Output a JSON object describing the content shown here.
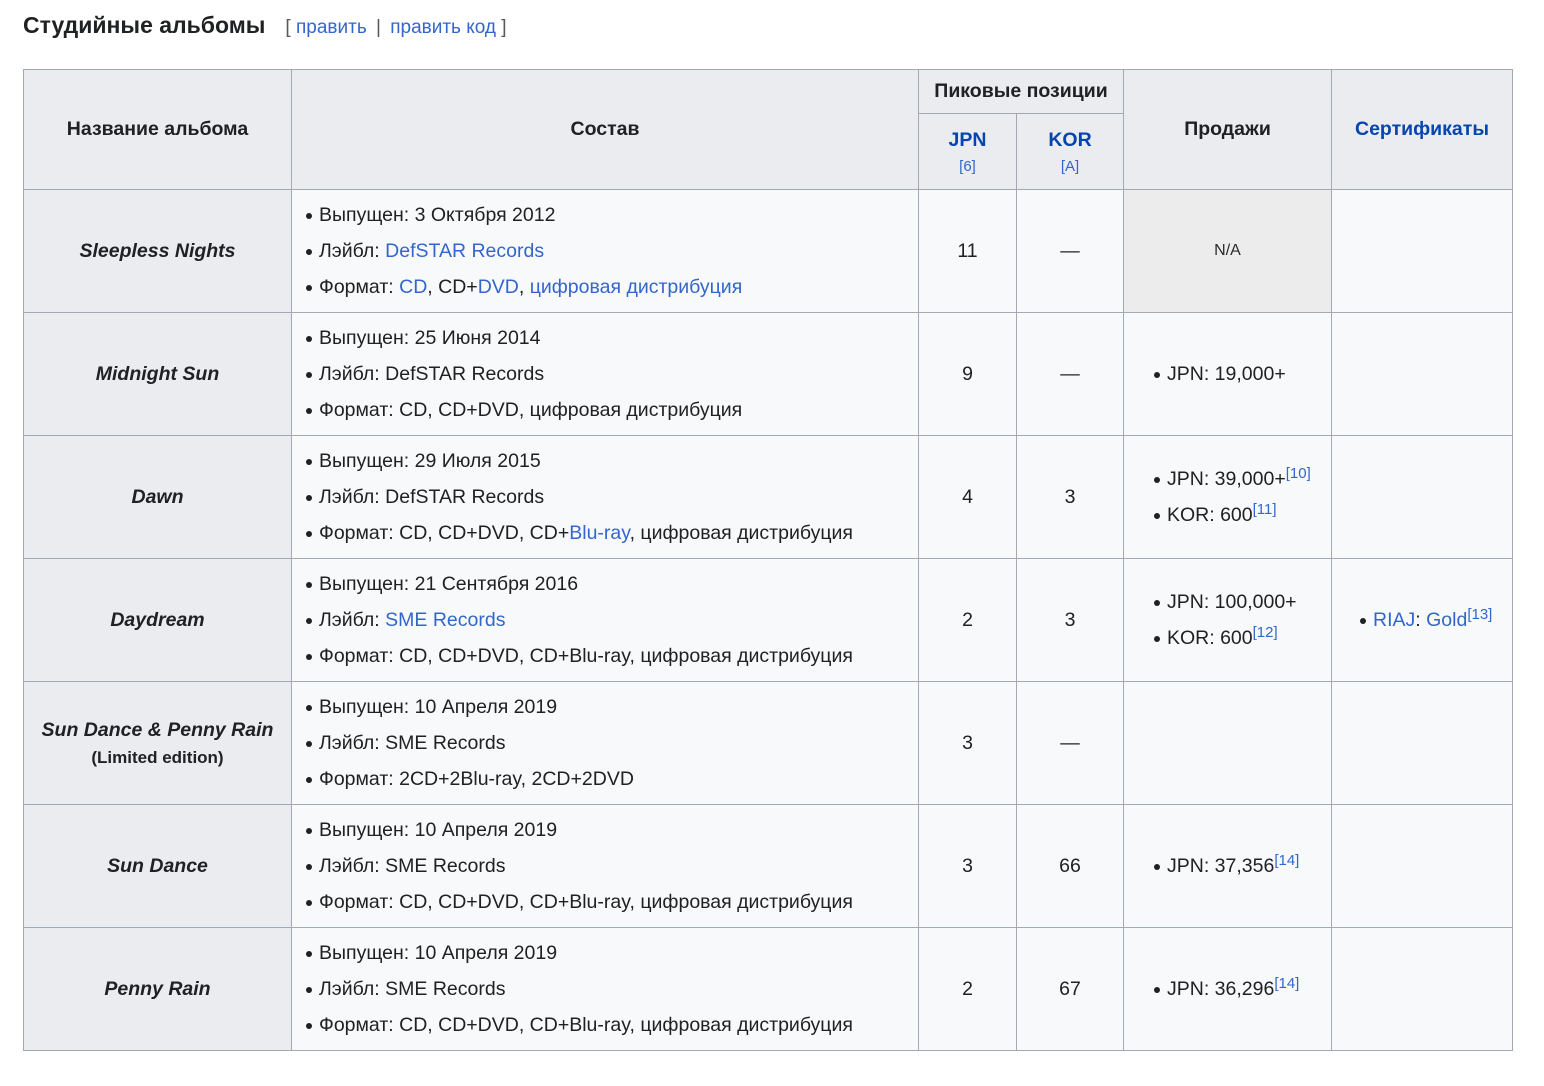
{
  "section": {
    "title": "Студийные альбомы",
    "edit_open": "[",
    "edit_label": "править",
    "edit_sep": "|",
    "edit_code_label": "править код",
    "edit_close": "]"
  },
  "headers": {
    "album": "Название альбома",
    "details": "Состав",
    "peak": "Пиковые позиции",
    "jpn": "JPN",
    "jpn_ref": "[6]",
    "kor": "KOR",
    "kor_ref": "[A]",
    "sales": "Продажи",
    "certs": "Сертификаты"
  },
  "labels": {
    "released": "Выпущен:",
    "label": "Лэйбл:",
    "format": "Формат:"
  },
  "rows": [
    {
      "title": "Sleepless Nights",
      "released": "3 Октября 2012",
      "label_name": "DefSTAR Records",
      "format_cd": "CD",
      "format_cddvd_prefix": "CD+",
      "format_dvd": "DVD",
      "format_digital": "цифровая дистрибуция",
      "jpn": "11",
      "kor": "—",
      "sales_na": "N/A"
    },
    {
      "title": "Midnight Sun",
      "released": "25 Июня 2014",
      "label_name": "DefSTAR Records",
      "format": "CD, CD+DVD, цифровая дистрибуция",
      "jpn": "9",
      "kor": "—",
      "sales": [
        "JPN: 19,000+"
      ]
    },
    {
      "title": "Dawn",
      "released": "29 Июля 2015",
      "label_name": "DefSTAR Records",
      "format_prefix": "CD, CD+DVD, CD+",
      "format_bluray": "Blu-ray",
      "format_suffix": ", цифровая дистрибуция",
      "jpn": "4",
      "kor": "3",
      "sales": [
        {
          "text": "JPN: 39,000+",
          "ref": "[10]"
        },
        {
          "text": "KOR: 600",
          "ref": "[11]"
        }
      ]
    },
    {
      "title": "Daydream",
      "released": "21 Сентября 2016",
      "label_name": "SME Records",
      "format": "CD, CD+DVD, CD+Blu-ray, цифровая дистрибуция",
      "jpn": "2",
      "kor": "3",
      "sales": [
        {
          "text": "JPN: 100,000+"
        },
        {
          "text": "KOR: 600",
          "ref": "[12]"
        }
      ],
      "cert_org": "RIAJ",
      "cert_sep": ":",
      "cert_level": "Gold",
      "cert_ref": "[13]"
    },
    {
      "title": "Sun Dance & Penny Rain",
      "edition": "(Limited edition)",
      "released": "10 Апреля 2019",
      "label_name": "SME Records",
      "format": "2CD+2Blu-ray, 2CD+2DVD",
      "jpn": "3",
      "kor": "—"
    },
    {
      "title": "Sun Dance",
      "released": "10 Апреля 2019",
      "label_name": "SME Records",
      "format": "CD, CD+DVD, CD+Blu-ray, цифровая дистрибуция",
      "jpn": "3",
      "kor": "66",
      "sales": [
        {
          "text": "JPN: 37,356",
          "ref": "[14]"
        }
      ]
    },
    {
      "title": "Penny Rain",
      "released": "10 Апреля 2019",
      "label_name": "SME Records",
      "format": "CD, CD+DVD, CD+Blu-ray, цифровая дистрибуция",
      "jpn": "2",
      "kor": "67",
      "sales": [
        {
          "text": "JPN: 36,296",
          "ref": "[14]"
        }
      ]
    }
  ]
}
